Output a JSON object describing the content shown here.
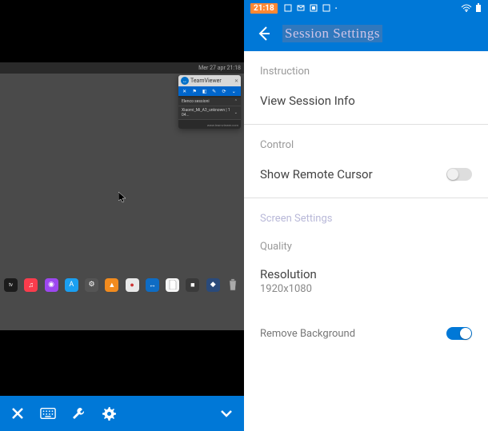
{
  "left": {
    "menubar": {
      "datetime": "Mer 27 apr  21:18"
    },
    "teamviewer": {
      "label": "TeamViewer",
      "sessions": [
        {
          "name": "Elenco sessioni"
        },
        {
          "name": "Xiaomi_Mi_A3_unknown | 1 04..."
        }
      ],
      "footer": "www.teamviewer.com"
    },
    "dock": [
      {
        "name": "appletv",
        "color": "#1c1c1c",
        "glyph": "tv"
      },
      {
        "name": "music",
        "color": "#fa3c4c",
        "glyph": "♫"
      },
      {
        "name": "podcasts",
        "color": "#9d47f0",
        "glyph": "◉"
      },
      {
        "name": "appstore",
        "color": "#1a9ff1",
        "glyph": "A"
      },
      {
        "name": "settings",
        "color": "#555",
        "glyph": "⚙"
      },
      {
        "name": "vlc",
        "color": "#f28b1e",
        "glyph": "▲"
      },
      {
        "name": "app1",
        "color": "#e8e8e8",
        "glyph": "●"
      },
      {
        "name": "teamviewer-dock",
        "color": "#0e6cc4",
        "glyph": "↔"
      },
      {
        "name": "document",
        "color": "#f5f5f5",
        "glyph": "📄"
      },
      {
        "name": "app2",
        "color": "#3a3a3a",
        "glyph": "■"
      },
      {
        "name": "app3",
        "color": "#2a4a7a",
        "glyph": "◆"
      },
      {
        "name": "trash",
        "color": "#888",
        "glyph": "🗑"
      }
    ],
    "toolbar": {
      "close": "close-icon",
      "keyboard": "keyboard-icon",
      "wrench": "wrench-icon",
      "gear": "gear-icon",
      "collapse": "chevron-down-icon"
    }
  },
  "right": {
    "statusbar": {
      "time": "21:18"
    },
    "header": {
      "title": "Session Settings"
    },
    "sections": {
      "instruction": {
        "label": "Instruction",
        "view_info": "View Session Info"
      },
      "control": {
        "label": "Control",
        "remote_cursor": "Show Remote Cursor",
        "remote_cursor_on": false
      },
      "screen": {
        "label": "Screen Settings",
        "quality": "Quality",
        "resolution_label": "Resolution",
        "resolution_value": "1920x1080",
        "remove_bg": "Remove Background",
        "remove_bg_on": true
      }
    }
  }
}
